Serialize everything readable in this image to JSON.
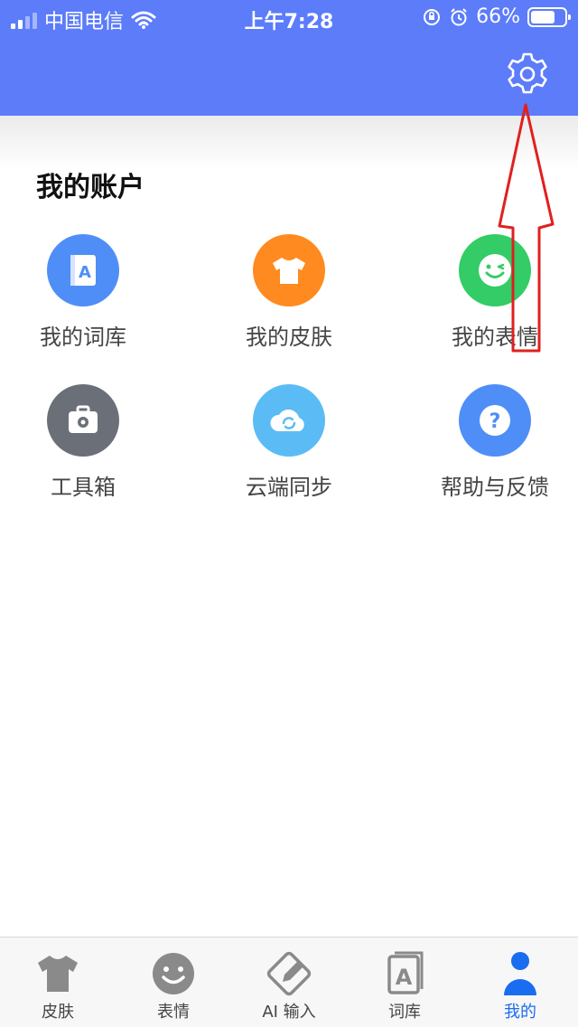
{
  "status_bar": {
    "carrier": "中国电信",
    "time": "上午7:28",
    "battery": "66%"
  },
  "account": {
    "title": "我的账户",
    "items": [
      {
        "label": "我的词库",
        "icon": "dictionary-icon",
        "color": "#4f8ef7"
      },
      {
        "label": "我的皮肤",
        "icon": "tshirt-icon",
        "color": "#ff8a1f"
      },
      {
        "label": "我的表情",
        "icon": "emoji-wink-icon",
        "color": "#33cc66"
      },
      {
        "label": "工具箱",
        "icon": "toolbox-icon",
        "color": "#6b6f78"
      },
      {
        "label": "云端同步",
        "icon": "cloud-sync-icon",
        "color": "#5bbcf5"
      },
      {
        "label": "帮助与反馈",
        "icon": "help-icon",
        "color": "#4f8ef7"
      }
    ]
  },
  "tabbar": {
    "tabs": [
      {
        "label": "皮肤",
        "icon": "tshirt-icon"
      },
      {
        "label": "表情",
        "icon": "smiley-icon"
      },
      {
        "label": "AI 输入",
        "icon": "pen-icon"
      },
      {
        "label": "词库",
        "icon": "dictionary-icon"
      },
      {
        "label": "我的",
        "icon": "user-icon",
        "active": true
      }
    ]
  },
  "colors": {
    "header": "#5c7cfa",
    "active_tab": "#1a6cf0",
    "annotation_arrow": "#e02020"
  }
}
